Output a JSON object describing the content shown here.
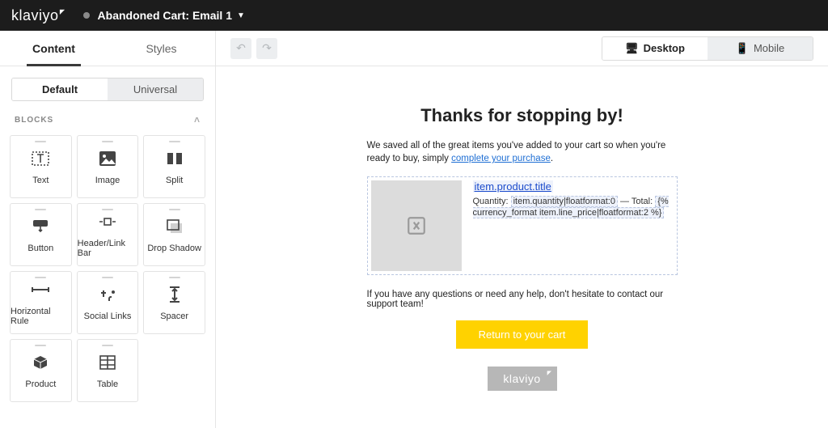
{
  "topbar": {
    "brand": "klaviyo",
    "doc_title": "Abandoned Cart: Email 1"
  },
  "sidebar": {
    "tabs": {
      "content": "Content",
      "styles": "Styles"
    },
    "subtabs": {
      "default": "Default",
      "universal": "Universal"
    },
    "blocks_header": "BLOCKS",
    "blocks": [
      {
        "name": "text",
        "label": "Text"
      },
      {
        "name": "image",
        "label": "Image"
      },
      {
        "name": "split",
        "label": "Split"
      },
      {
        "name": "button",
        "label": "Button"
      },
      {
        "name": "headerlink",
        "label": "Header/Link Bar"
      },
      {
        "name": "dropshadow",
        "label": "Drop Shadow"
      },
      {
        "name": "hr",
        "label": "Horizontal Rule"
      },
      {
        "name": "social",
        "label": "Social Links"
      },
      {
        "name": "spacer",
        "label": "Spacer"
      },
      {
        "name": "product",
        "label": "Product"
      },
      {
        "name": "table",
        "label": "Table"
      }
    ]
  },
  "canvas_toolbar": {
    "desktop": "Desktop",
    "mobile": "Mobile"
  },
  "email": {
    "heading": "Thanks for stopping by!",
    "intro_prefix": "We saved all of the great items you've added to your cart so when you're ready to buy, simply ",
    "intro_link": "complete your purchase",
    "intro_suffix": ".",
    "product_title_token": "item.product.title",
    "qty_label": "Quantity: ",
    "qty_token": "item.quantity|floatformat:0",
    "qty_separator": " — Total: ",
    "total_token": "{% currency_format item.line_price|floatformat:2 %}",
    "support_text": "If you have any questions or need any help, don't hesitate to contact our support team!",
    "cta": "Return to your cart",
    "footer_brand": "klaviyo"
  }
}
